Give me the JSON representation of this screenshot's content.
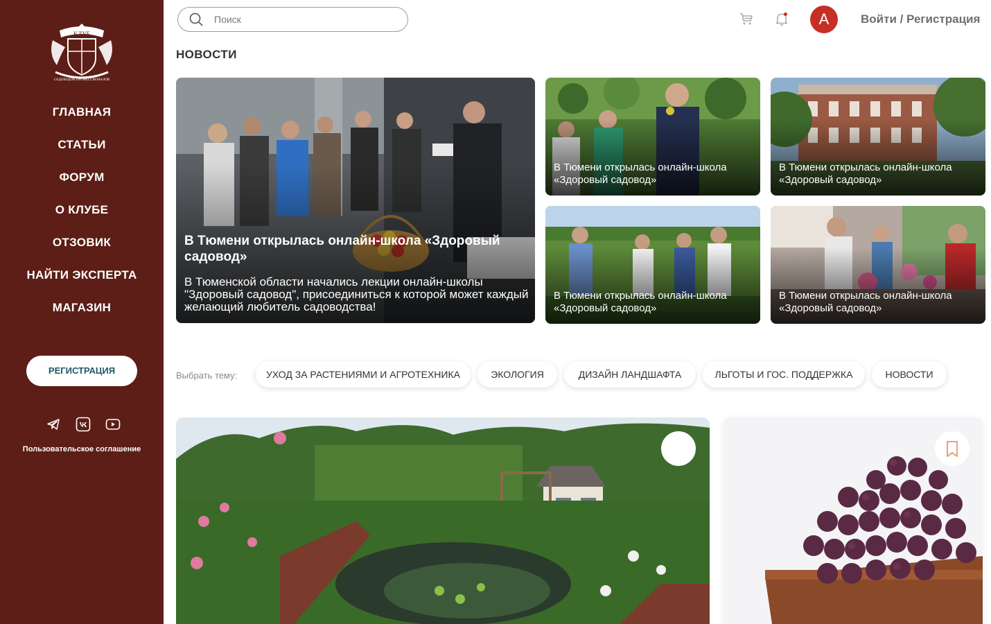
{
  "logo": {
    "text_top": "КЛУБ",
    "text_bottom": "САДОВОДОВ ПРОФЕССИОНАЛОВ"
  },
  "sidebar": {
    "nav": [
      {
        "label": "ГЛАВНАЯ"
      },
      {
        "label": "СТАТЬИ"
      },
      {
        "label": "ФОРУМ"
      },
      {
        "label": "О КЛУБЕ"
      },
      {
        "label": "ОТЗОВИК"
      },
      {
        "label": "НАЙТИ ЭКСПЕРТА"
      },
      {
        "label": "МАГАЗИН"
      }
    ],
    "register_label": "РЕГИСТРАЦИЯ",
    "socials": [
      "telegram-icon",
      "vk-icon",
      "youtube-icon"
    ],
    "agreement": "Пользовательское соглашение"
  },
  "header": {
    "search_placeholder": "Поиск",
    "avatar_letter": "А",
    "login_label": "Войти / Регистрация"
  },
  "news": {
    "title": "НОВОСТИ",
    "main": {
      "title": "В Тюмени открылась онлайн-школа «Здоровый садовод»",
      "description": "В Тюменской области начались лекции онлайн-школы \"Здоровый садовод\", присоединиться к которой может каждый желающий любитель садоводства!"
    },
    "items": [
      {
        "caption": "В Тюмени открылась онлайн-школа «Здоровый садовод»"
      },
      {
        "caption": "В Тюмени открылась онлайн-школа «Здоровый садовод»"
      },
      {
        "caption": "В Тюмени открылась онлайн-школа «Здоровый садовод»"
      },
      {
        "caption": "В Тюмени открылась онлайн-школа «Здоровый садовод»"
      }
    ]
  },
  "topics": {
    "label": "Выбрать тему:",
    "chips": [
      {
        "label": "УХОД ЗА РАСТЕНИЯМИ И АГРОТЕХНИКА"
      },
      {
        "label": "ЭКОЛОГИЯ"
      },
      {
        "label": "ДИЗАЙН ЛАНДШАФТА"
      },
      {
        "label": "ЛЬГОТЫ И ГОС. ПОДДЕРЖКА"
      },
      {
        "label": "НОВОСТИ"
      }
    ]
  },
  "colors": {
    "sidebar": "#5c1e16",
    "avatar": "#c62f26",
    "accent": "#e8a07a",
    "register_text": "#1f5a66"
  }
}
